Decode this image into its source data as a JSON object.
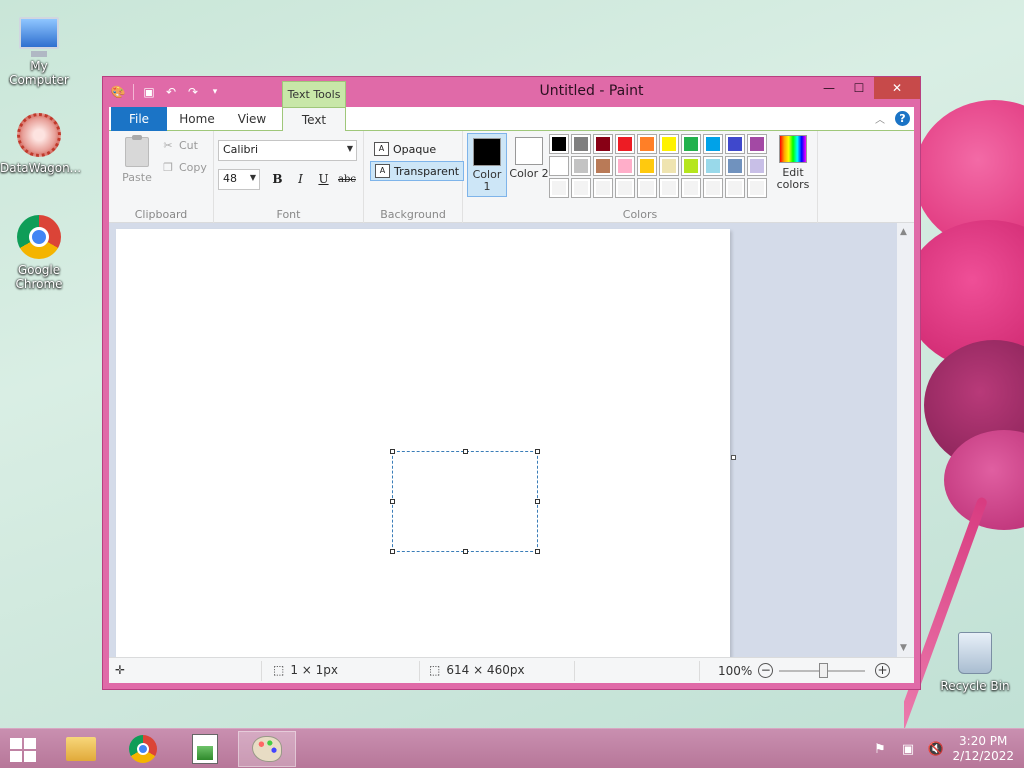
{
  "desktop": {
    "icons": [
      {
        "label": "My Computer"
      },
      {
        "label": "DataWagon..."
      },
      {
        "label": "Google Chrome"
      },
      {
        "label": "Recycle Bin"
      }
    ]
  },
  "window": {
    "title": "Untitled - Paint",
    "context_tab": "Text Tools",
    "tabs": [
      "File",
      "Home",
      "View",
      "Text"
    ],
    "active_tab": "Text"
  },
  "ribbon": {
    "clipboard": {
      "paste": "Paste",
      "cut": "Cut",
      "copy": "Copy",
      "label": "Clipboard"
    },
    "font": {
      "family": "Calibri",
      "size": "48",
      "bold": "B",
      "italic": "I",
      "underline": "U",
      "strike": "abc",
      "label": "Font"
    },
    "background": {
      "opaque": "Opaque",
      "transparent": "Transparent",
      "selected": "Transparent",
      "label": "Background"
    },
    "colors": {
      "color1_label": "Color 1",
      "color2_label": "Color 2",
      "color1": "#000000",
      "color2": "#ffffff",
      "edit": "Edit colors",
      "label": "Colors",
      "palette": [
        "#000000",
        "#7f7f7f",
        "#880015",
        "#ed1c24",
        "#ff7f27",
        "#fff200",
        "#22b14c",
        "#00a2e8",
        "#3f48cc",
        "#a349a4",
        "#ffffff",
        "#c3c3c3",
        "#b97a57",
        "#ffaec9",
        "#ffc90e",
        "#efe4b0",
        "#b5e61d",
        "#99d9ea",
        "#7092be",
        "#c8bfe7",
        "#ffffff",
        "#ffffff",
        "#ffffff",
        "#ffffff",
        "#ffffff",
        "#ffffff",
        "#ffffff",
        "#ffffff",
        "#ffffff",
        "#ffffff"
      ]
    }
  },
  "status": {
    "selection_size": "1 × 1px",
    "image_size": "614 × 460px",
    "zoom": "100%"
  },
  "taskbar": {
    "time": "3:20 PM",
    "date": "2/12/2022"
  }
}
